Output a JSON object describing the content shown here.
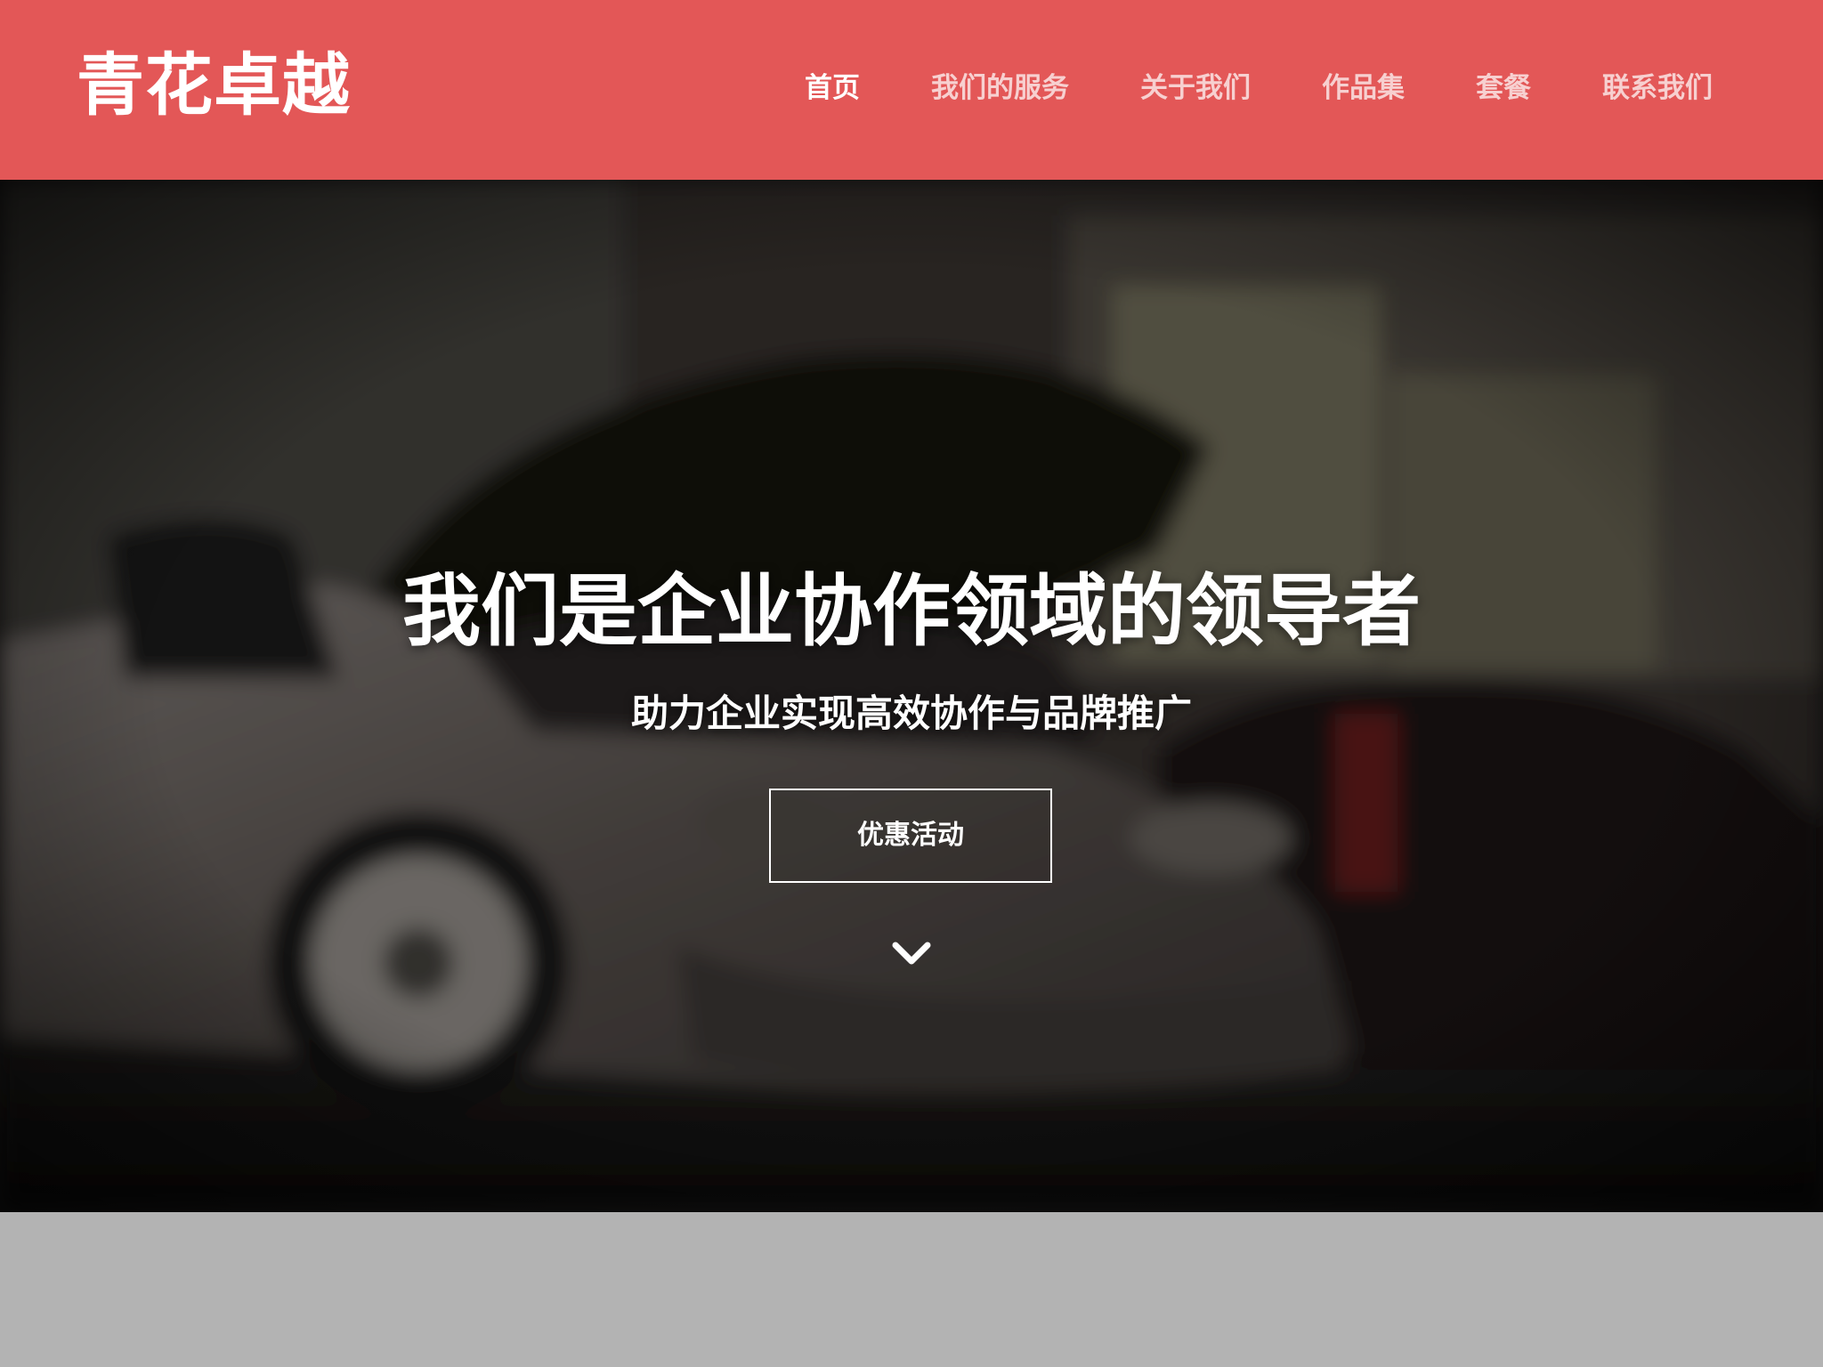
{
  "header": {
    "brand": "青花卓越",
    "background_color": "#e35757",
    "nav": [
      {
        "label": "首页",
        "active": true
      },
      {
        "label": "我们的服务",
        "active": false
      },
      {
        "label": "关于我们",
        "active": false
      },
      {
        "label": "作品集",
        "active": false
      },
      {
        "label": "套餐",
        "active": false
      },
      {
        "label": "联系我们",
        "active": false
      }
    ]
  },
  "hero": {
    "title": "我们是企业协作领域的领导者",
    "subtitle": "助力企业实现高效协作与品牌推广",
    "cta_label": "优惠活动",
    "scroll_icon": "chevron-down-icon",
    "background_image": "blurred photo of a sports car with open hood in a repair garage"
  },
  "footer": {
    "background_color": "#b3b3b3"
  }
}
